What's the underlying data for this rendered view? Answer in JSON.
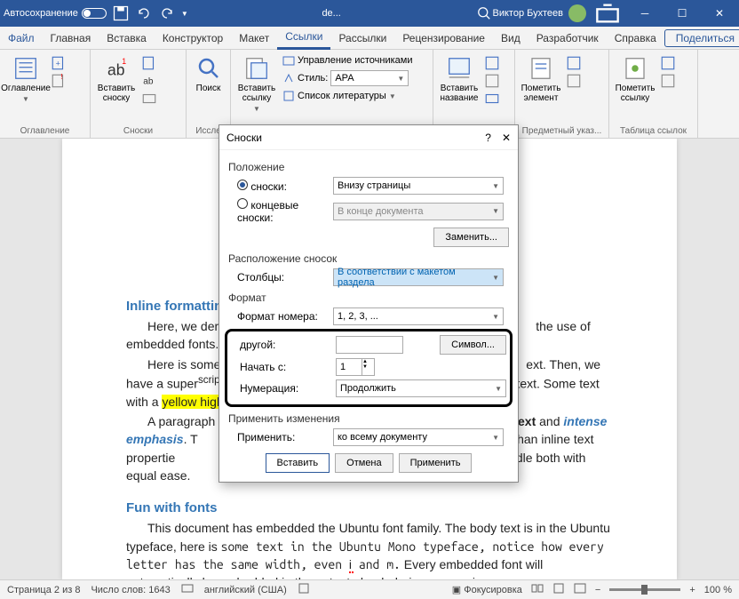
{
  "titlebar": {
    "autosave": "Автосохранение",
    "docname": "de...",
    "search_icon": "O",
    "username": "Виктор Бухтеев"
  },
  "menubar": {
    "file": "Файл",
    "items": [
      "Главная",
      "Вставка",
      "Конструктор",
      "Макет",
      "Ссылки",
      "Рассылки",
      "Рецензирование",
      "Вид",
      "Разработчик",
      "Справка"
    ],
    "active_index": 4,
    "share": "Поделиться"
  },
  "ribbon": {
    "toc": {
      "btn": "Оглавление",
      "group": "Оглавление"
    },
    "footnote": {
      "btn": "Вставить сноску",
      "ab": "ab",
      "group": "Сноски"
    },
    "search": {
      "btn": "Поиск",
      "group": "Иссле"
    },
    "citation": {
      "btn": "Вставить ссылку",
      "sources": "Управление источниками",
      "style": "Стиль:",
      "style_val": "APA",
      "bib": "Список литературы"
    },
    "caption": {
      "btn": "Вставить название"
    },
    "index": {
      "btn": "Пометить элемент",
      "group": "Предметный указ..."
    },
    "toa": {
      "btn": "Пометить ссылку",
      "group": "Таблица ссылок"
    }
  },
  "dialog": {
    "title": "Сноски",
    "pos_section": "Положение",
    "footnotes": "сноски:",
    "footnotes_val": "Внизу страницы",
    "endnotes": "концевые сноски:",
    "endnotes_val": "В конце документа",
    "change": "Заменить...",
    "layout_section": "Расположение сносок",
    "columns": "Столбцы:",
    "columns_val": "В соответствии с макетом раздела",
    "format_section": "Формат",
    "num_format": "Формат номера:",
    "num_format_val": "1, 2, 3, ...",
    "other": "другой:",
    "symbol": "Символ...",
    "start_at": "Начать с:",
    "start_val": "1",
    "numbering": "Нумерация:",
    "numbering_val": "Продолжить",
    "apply_section": "Применить изменения",
    "apply_to": "Применить:",
    "apply_val": "ко всему документу",
    "insert": "Вставить",
    "cancel": "Отмена",
    "apply": "Применить"
  },
  "doc": {
    "h1": "Inline formatting",
    "h2": "Fun with fonts"
  },
  "statusbar": {
    "page": "Страница 2 из 8",
    "words": "Число слов: 1643",
    "lang": "английский (США)",
    "focus": "Фокусировка",
    "zoom": "100 %"
  }
}
